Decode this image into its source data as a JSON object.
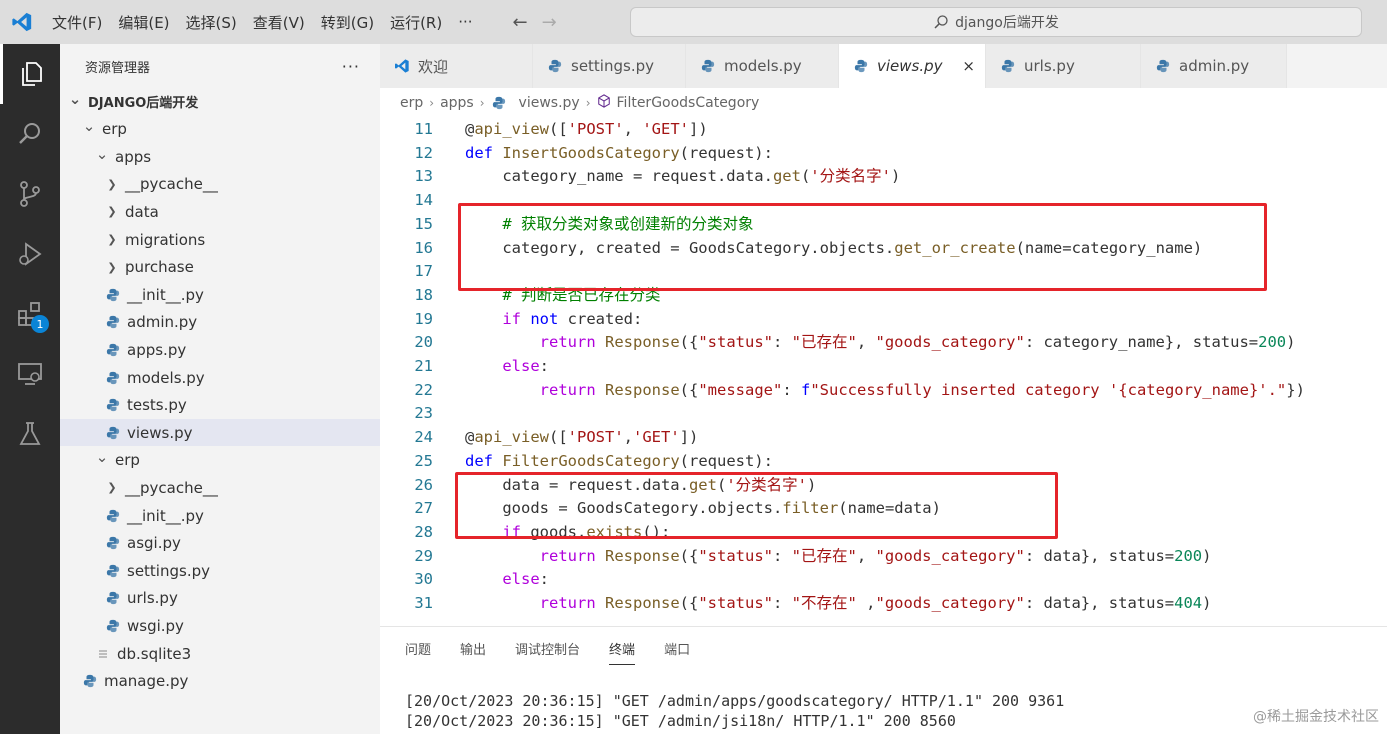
{
  "menu": [
    "文件(F)",
    "编辑(E)",
    "选择(S)",
    "查看(V)",
    "转到(G)",
    "运行(R)",
    "···"
  ],
  "command_center": "django后端开发",
  "explorer": {
    "title": "资源管理器",
    "more": "···",
    "root": "DJANGO后端开发",
    "items": [
      {
        "label": "erp",
        "type": "folder-open",
        "level": 1
      },
      {
        "label": "apps",
        "type": "folder-open",
        "level": 2
      },
      {
        "label": "__pycache__",
        "type": "folder",
        "level": 3
      },
      {
        "label": "data",
        "type": "folder",
        "level": 3
      },
      {
        "label": "migrations",
        "type": "folder",
        "level": 3
      },
      {
        "label": "purchase",
        "type": "folder",
        "level": 3
      },
      {
        "label": "__init__.py",
        "type": "py",
        "level": 3
      },
      {
        "label": "admin.py",
        "type": "py",
        "level": 3
      },
      {
        "label": "apps.py",
        "type": "py",
        "level": 3
      },
      {
        "label": "models.py",
        "type": "py",
        "level": 3
      },
      {
        "label": "tests.py",
        "type": "py",
        "level": 3
      },
      {
        "label": "views.py",
        "type": "py",
        "level": 3,
        "selected": true
      },
      {
        "label": "erp",
        "type": "folder-open",
        "level": 2
      },
      {
        "label": "__pycache__",
        "type": "folder",
        "level": 3
      },
      {
        "label": "__init__.py",
        "type": "py",
        "level": 3
      },
      {
        "label": "asgi.py",
        "type": "py",
        "level": 3
      },
      {
        "label": "settings.py",
        "type": "py",
        "level": 3
      },
      {
        "label": "urls.py",
        "type": "py",
        "level": 3
      },
      {
        "label": "wsgi.py",
        "type": "py",
        "level": 3
      },
      {
        "label": "db.sqlite3",
        "type": "file",
        "level": 2
      },
      {
        "label": "manage.py",
        "type": "py",
        "level": 1
      }
    ]
  },
  "activity_badge": "1",
  "tabs": [
    {
      "label": "欢迎",
      "icon": "vscode-icon"
    },
    {
      "label": "settings.py",
      "icon": "python-icon"
    },
    {
      "label": "models.py",
      "icon": "python-icon"
    },
    {
      "label": "views.py",
      "icon": "python-icon",
      "active": true,
      "close": "×"
    },
    {
      "label": "urls.py",
      "icon": "python-icon"
    },
    {
      "label": "admin.py",
      "icon": "python-icon"
    }
  ],
  "breadcrumb": [
    "erp",
    "apps",
    "views.py",
    "FilterGoodsCategory"
  ],
  "code": [
    {
      "n": "11",
      "t": "@api_view(['POST', 'GET'])"
    },
    {
      "n": "12",
      "t": "def InsertGoodsCategory(request):"
    },
    {
      "n": "13",
      "t": "    category_name = request.data.get('分类名字')"
    },
    {
      "n": "14",
      "t": ""
    },
    {
      "n": "15",
      "t": "    # 获取分类对象或创建新的分类对象"
    },
    {
      "n": "16",
      "t": "    category, created = GoodsCategory.objects.get_or_create(name=category_name)"
    },
    {
      "n": "17",
      "t": ""
    },
    {
      "n": "18",
      "t": "    # 判断是否已存在分类"
    },
    {
      "n": "19",
      "t": "    if not created:"
    },
    {
      "n": "20",
      "t": "        return Response({\"status\": \"已存在\", \"goods_category\": category_name}, status=200)"
    },
    {
      "n": "21",
      "t": "    else:"
    },
    {
      "n": "22",
      "t": "        return Response({\"message\": f\"Successfully inserted category '{category_name}'.\"})"
    },
    {
      "n": "23",
      "t": ""
    },
    {
      "n": "24",
      "t": "@api_view(['POST','GET'])"
    },
    {
      "n": "25",
      "t": "def FilterGoodsCategory(request):"
    },
    {
      "n": "26",
      "t": "    data = request.data.get('分类名字')"
    },
    {
      "n": "27",
      "t": "    goods = GoodsCategory.objects.filter(name=data)"
    },
    {
      "n": "28",
      "t": "    if goods.exists():"
    },
    {
      "n": "29",
      "t": "        return Response({\"status\": \"已存在\", \"goods_category\": data}, status=200)"
    },
    {
      "n": "30",
      "t": "    else:"
    },
    {
      "n": "31",
      "t": "        return Response({\"status\": \"不存在\" ,\"goods_category\": data}, status=404)"
    }
  ],
  "panel": {
    "tabs": [
      "问题",
      "输出",
      "调试控制台",
      "终端",
      "端口"
    ],
    "active_tab": "终端",
    "lines": [
      "[20/Oct/2023 20:36:15] \"GET /admin/apps/goodscategory/ HTTP/1.1\" 200 9361",
      "[20/Oct/2023 20:36:15] \"GET /admin/jsi18n/ HTTP/1.1\" 200 8560"
    ]
  },
  "watermark": "@稀土掘金技术社区",
  "colors": {
    "activity_bg": "#2c2c2c",
    "sidebar_bg": "#f3f3f3",
    "highlight_box": "#e5242a",
    "badge": "#0a84d6"
  }
}
